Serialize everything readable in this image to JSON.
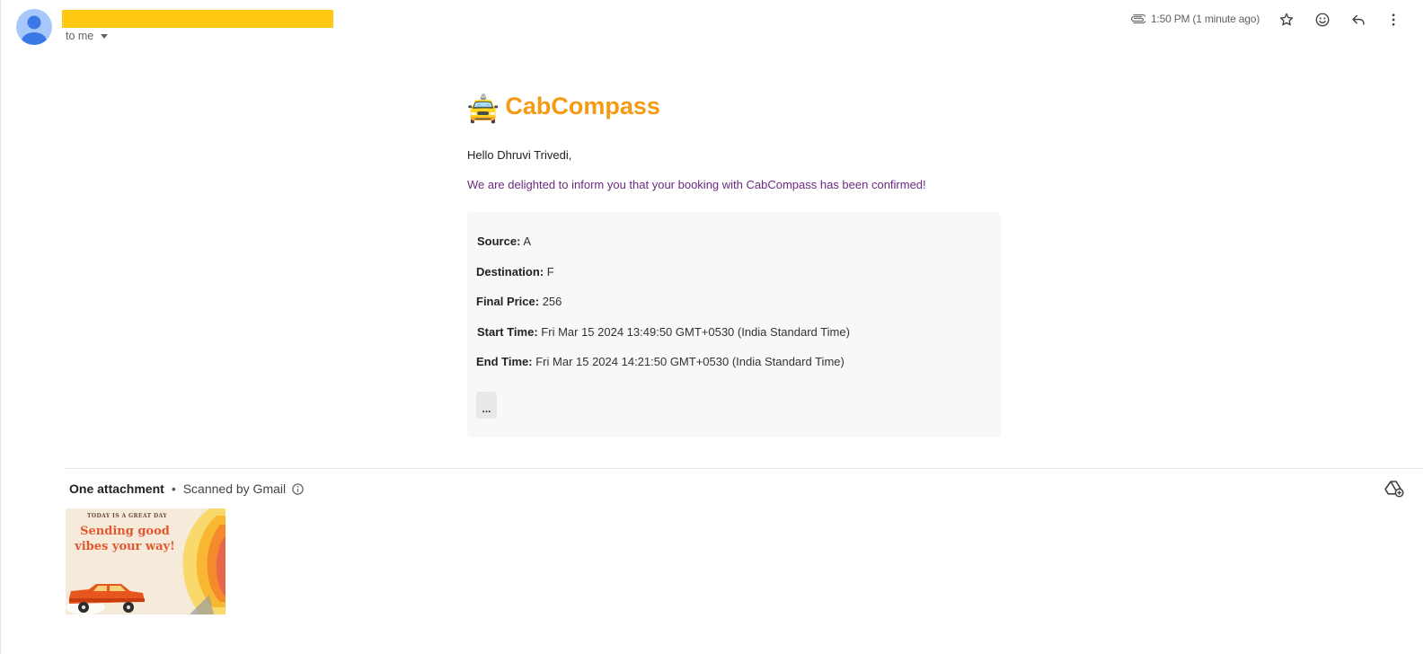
{
  "header": {
    "recipient_label": "to me",
    "timestamp": "1:50 PM (1 minute ago)",
    "icons": [
      "attachment-icon",
      "star-icon",
      "emoji-icon",
      "reply-icon",
      "more-vert-icon"
    ]
  },
  "email": {
    "brand_emoji": "🚖",
    "brand_name": "CabCompass",
    "greeting": "Hello Dhruvi Trivedi,",
    "intro": "We are delighted to inform you that your booking with CabCompass has been confirmed!",
    "details": {
      "source_label": "Source:",
      "source_value": "A",
      "destination_label": "Destination:",
      "destination_value": "F",
      "price_label": "Final Price:",
      "price_value": "256",
      "start_label": "Start Time:",
      "start_value": "Fri Mar 15 2024 13:49:50 GMT+0530 (India Standard Time)",
      "end_label": "End Time:",
      "end_value": "Fri Mar 15 2024 14:21:50 GMT+0530 (India Standard Time)"
    },
    "more_label": "..."
  },
  "attachments": {
    "count_label": "One attachment",
    "separator": "•",
    "scan_label": "Scanned by Gmail",
    "thumbnail": {
      "small_text": "TODAY IS A GREAT DAY",
      "big_text": "Sending good vibes your way!"
    }
  },
  "colors": {
    "brand": "#f59a11",
    "intro_text": "#6b2a82",
    "sender_highlight": "#ffc811",
    "avatar_bg": "#a8c7fa",
    "avatar_fg": "#1a73e8"
  }
}
